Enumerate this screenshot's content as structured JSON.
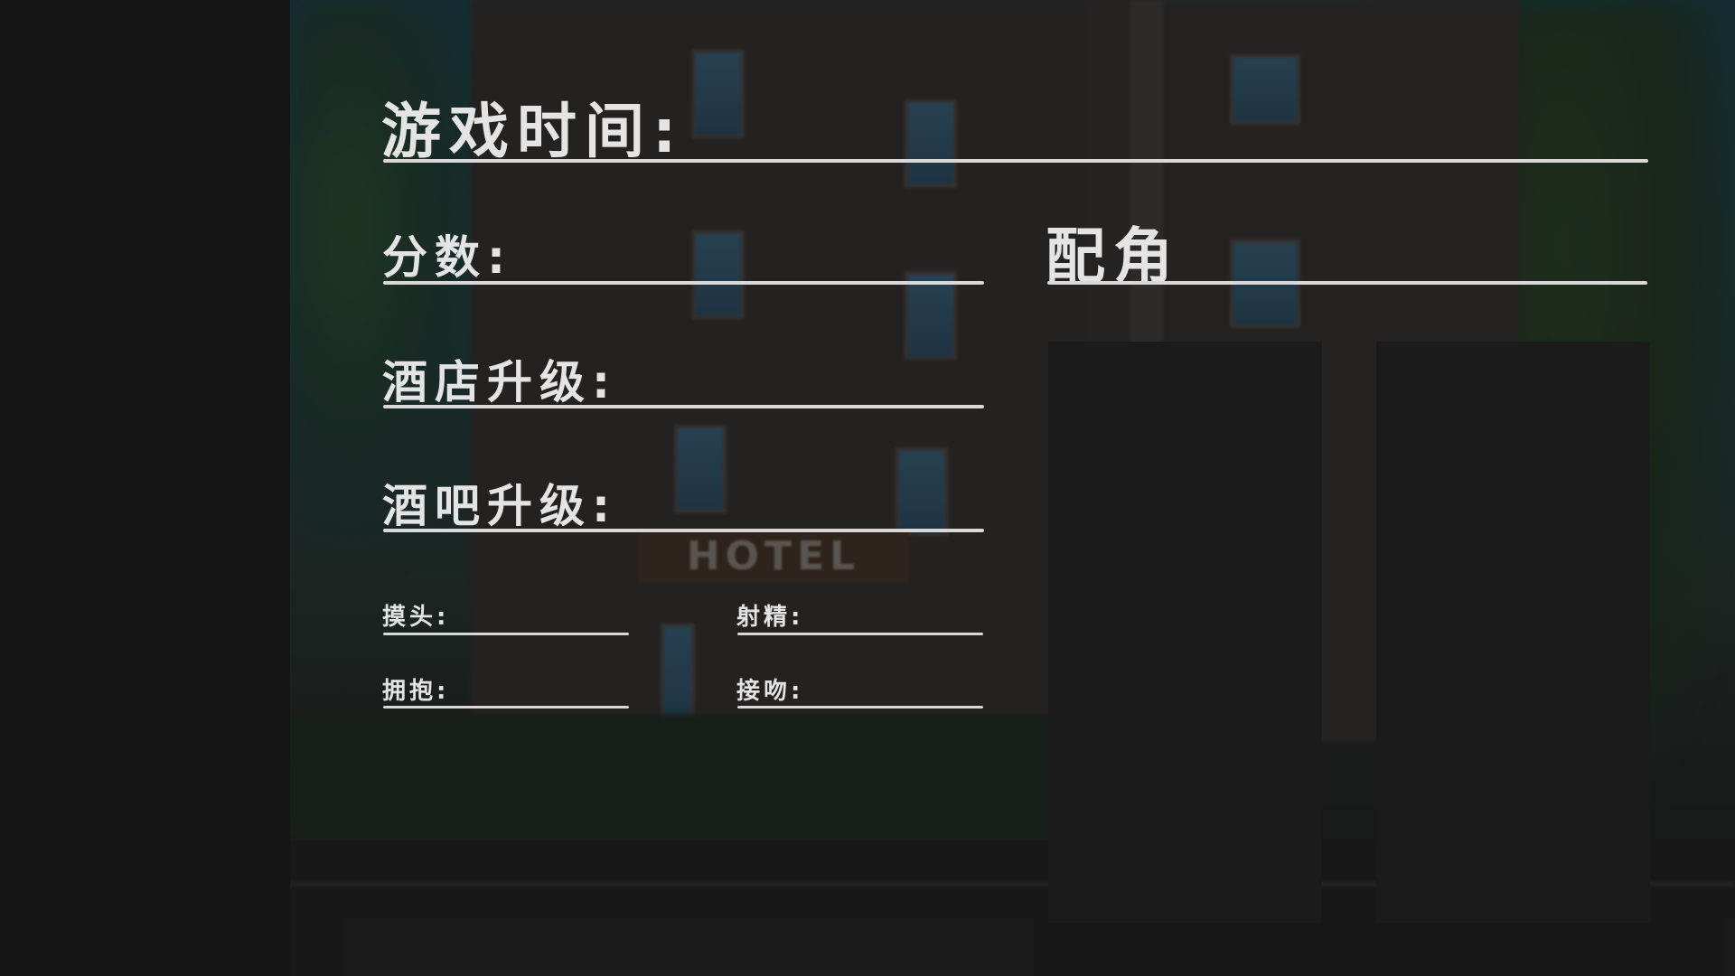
{
  "stats": {
    "play_time_label": "游戏时间:",
    "score_label": "分数:",
    "hotel_upgrade_label": "酒店升级:",
    "bar_upgrade_label": "酒吧升级:"
  },
  "actions": {
    "touch_head_label": "摸头:",
    "ejaculate_label": "射精:",
    "hug_label": "拥抱:",
    "kiss_label": "接吻:"
  },
  "side_characters": {
    "title": "配角",
    "slots": 2
  },
  "background": {
    "sign_text": "HOTEL"
  },
  "colors": {
    "text": "#e4e4e4",
    "underline": "#d8d8d8",
    "panel": "#161616",
    "slot": "#1b1b1b"
  }
}
